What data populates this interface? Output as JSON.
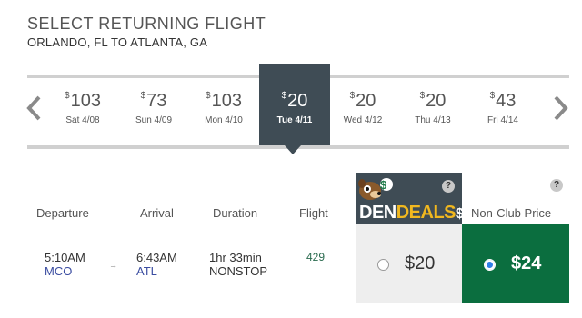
{
  "header": {
    "title": "SELECT RETURNING FLIGHT",
    "route": "ORLANDO, FL TO ATLANTA, GA"
  },
  "date_strip": {
    "currency": "$",
    "days": [
      {
        "price": "103",
        "date": "Sat 4/08",
        "selected": false
      },
      {
        "price": "73",
        "date": "Sun 4/09",
        "selected": false
      },
      {
        "price": "103",
        "date": "Mon 4/10",
        "selected": false
      },
      {
        "price": "20",
        "date": "Tue 4/11",
        "selected": true
      },
      {
        "price": "20",
        "date": "Wed 4/12",
        "selected": false
      },
      {
        "price": "20",
        "date": "Thu 4/13",
        "selected": false
      },
      {
        "price": "43",
        "date": "Fri 4/14",
        "selected": false
      }
    ]
  },
  "dendeals": {
    "logo_part1": "DEN",
    "logo_part2": "DEALS",
    "logo_symbol": "$",
    "help": "?"
  },
  "nonclub_help": "?",
  "columns": {
    "departure": "Departure",
    "arrival": "Arrival",
    "duration": "Duration",
    "flight": "Flight",
    "nonclub": "Non-Club Price"
  },
  "flight": {
    "depart_time": "5:10AM",
    "depart_code": "MCO",
    "arrow": "→",
    "arrive_time": "6:43AM",
    "arrive_code": "ATL",
    "duration": "1hr 33min",
    "stops": "NONSTOP",
    "number": "429",
    "club_price": "$20",
    "nonclub_price": "$24",
    "selected_fare": "nonclub"
  },
  "colors": {
    "dark_header": "#3f4c55",
    "nonclub_green": "#0b6e3f",
    "club_gray": "#eeeeee",
    "den_gold": "#f1b81f",
    "radio_blue": "#2e7ee8"
  }
}
